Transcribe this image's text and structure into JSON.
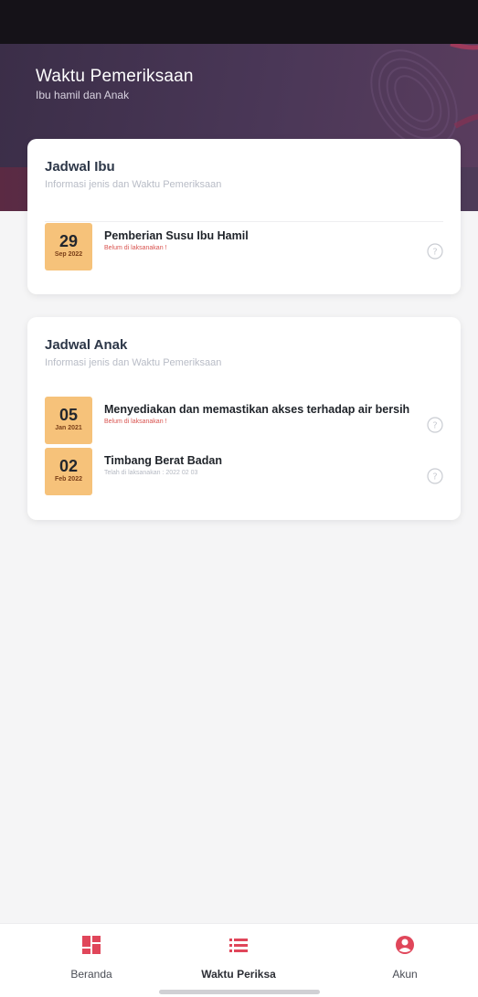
{
  "header": {
    "title": "Waktu Pemeriksaan",
    "subtitle": "Ibu hamil dan Anak"
  },
  "jadwal_ibu": {
    "title": "Jadwal Ibu",
    "subtitle": "Informasi jenis dan Waktu Pemeriksaan",
    "items": [
      {
        "day": "29",
        "month_year": "Sep 2022",
        "title": "Pemberian Susu Ibu Hamil",
        "status": "Belum di laksanakan !"
      }
    ]
  },
  "jadwal_anak": {
    "title": "Jadwal Anak",
    "subtitle": "Informasi jenis dan Waktu Pemeriksaan",
    "items": [
      {
        "day": "05",
        "month_year": "Jan 2021",
        "title": "Menyediakan dan memastikan akses terhadap air bersih",
        "status": "Belum di laksanakan !"
      },
      {
        "day": "02",
        "month_year": "Feb 2022",
        "title": "Timbang Berat Badan",
        "status": "Telah di laksanakan : 2022 02 03"
      }
    ]
  },
  "bottom_nav": {
    "items": [
      {
        "label": "Beranda",
        "icon": "dashboard-icon"
      },
      {
        "label": "Waktu Periksa",
        "icon": "list-icon",
        "active": true
      },
      {
        "label": "Akun",
        "icon": "account-icon"
      }
    ]
  },
  "colors": {
    "accent": "#e0465a",
    "date_box": "#f6c27a",
    "header_bg": "#40304f",
    "status_pending": "#d9534f"
  }
}
